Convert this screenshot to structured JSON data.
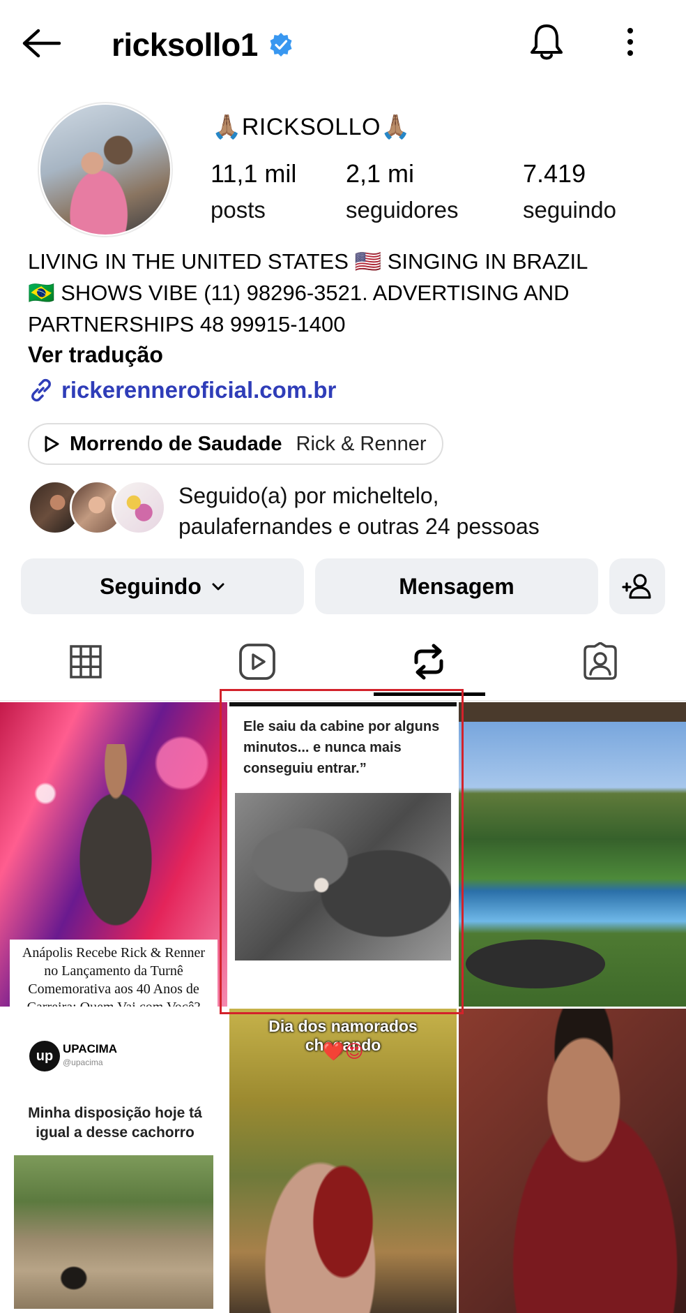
{
  "header": {
    "username": "ricksollo1",
    "verified": true,
    "icons": [
      "back-arrow-icon",
      "verified-badge-icon",
      "bell-icon",
      "more-vertical-icon"
    ]
  },
  "profile": {
    "display_name": "🙏🏽RICKSOLLO🙏🏽",
    "stats": [
      {
        "value": "11,1 mil",
        "label": "posts"
      },
      {
        "value": "2,1 mi",
        "label": "seguidores"
      },
      {
        "value": "7.419",
        "label": "seguindo"
      }
    ],
    "bio_lines": [
      "LIVING IN THE UNITED STATES 🇺🇸 SINGING IN BRAZIL",
      "🇧🇷 SHOWS VIBE  (11) 98296-3521. ADVERTISING AND",
      "PARTNERSHIPS 48 99915-1400"
    ],
    "translate_label": "Ver tradução",
    "link": "rickerenneroficial.com.br",
    "music": {
      "song": "Morrendo de Saudade",
      "artist": "Rick & Renner"
    },
    "followed_by_line1": "Seguido(a) por micheltelo,",
    "followed_by_line2": "paulafernandes e outras 24 pessoas"
  },
  "actions": {
    "following_label": "Seguindo",
    "message_label": "Mensagem"
  },
  "tabs": [
    {
      "icon": "grid-icon",
      "active": false
    },
    {
      "icon": "reels-icon",
      "active": false
    },
    {
      "icon": "repost-icon",
      "active": true
    },
    {
      "icon": "tagged-icon",
      "active": false
    }
  ],
  "posts": {
    "p1_caption": "Anápolis Recebe Rick & Renner no Lançamento da Turnê Comemorativa aos 40 Anos de Carreira: Quem Vai com Você?",
    "p2_quote": "Ele saiu da cabine por alguns minutos... e nunca mais conseguiu entrar.”",
    "p4_brand": "UPACIMA",
    "p4_handle": "@upacima",
    "p4_logo": "up",
    "p4_text": "Minha disposição hoje tá igual a desse cachorro",
    "p5_banner": "Dia dos namorados chegando",
    "p5_emojis": "❤️😍"
  },
  "colors": {
    "link": "#2f3db8",
    "verified": "#3897f0",
    "button_bg": "#eef0f3",
    "highlight": "#d3222b"
  }
}
